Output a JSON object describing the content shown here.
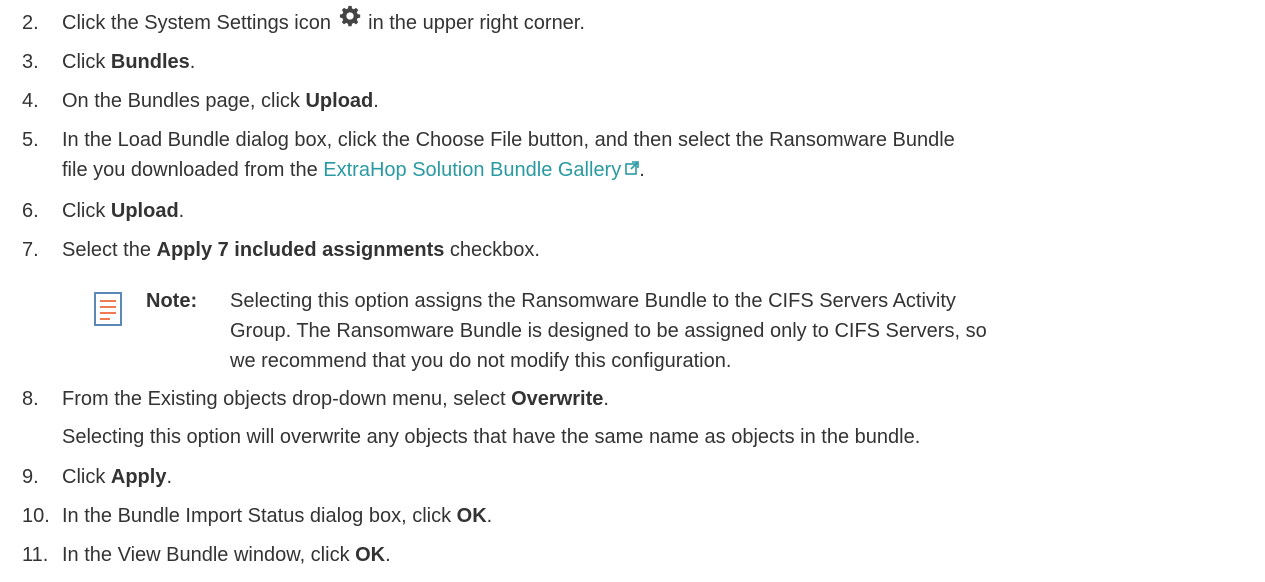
{
  "steps": [
    {
      "num": "2.",
      "pre": "Click the System Settings icon",
      "icon": "gear-icon",
      "post": "in the upper right corner."
    },
    {
      "num": "3.",
      "pre": "Click ",
      "bold": "Bundles",
      "post": "."
    },
    {
      "num": "4.",
      "pre": "On the Bundles page, click ",
      "bold": "Upload",
      "post": "."
    },
    {
      "num": "5.",
      "line1": "In the Load Bundle dialog box, click the Choose File button, and then select the Ransomware Bundle",
      "line2_pre": "file you downloaded from the ",
      "link": "ExtraHop Solution Bundle Gallery",
      "link_icon": "external-link-icon",
      "line2_post": "."
    },
    {
      "num": "6.",
      "pre": "Click ",
      "bold": "Upload",
      "post": "."
    },
    {
      "num": "7.",
      "pre": "Select the ",
      "bold": "Apply 7 included assignments",
      "post": " checkbox."
    },
    {
      "num": "8.",
      "pre": "From the Existing objects drop-down menu, select ",
      "bold": "Overwrite",
      "post": ".",
      "extra": "Selecting this option will overwrite any objects that have the same name as objects in the bundle."
    },
    {
      "num": "9.",
      "pre": "Click ",
      "bold": "Apply",
      "post": "."
    },
    {
      "num": "10.",
      "pre": "In the Bundle Import Status dialog box, click ",
      "bold": "OK",
      "post": "."
    },
    {
      "num": "11.",
      "pre": "In the View Bundle window, click ",
      "bold": "OK",
      "post": "."
    }
  ],
  "note": {
    "icon": "note-icon",
    "label": "Note:",
    "line1": "Selecting this option assigns the Ransomware Bundle to the CIFS Servers Activity",
    "line2": "Group. The Ransomware Bundle is designed to be assigned only to CIFS Servers, so",
    "line3": "we recommend that you do not modify this configuration."
  },
  "colors": {
    "text": "#333333",
    "link": "#2a9aa2",
    "note_icon": "#f07b52"
  }
}
